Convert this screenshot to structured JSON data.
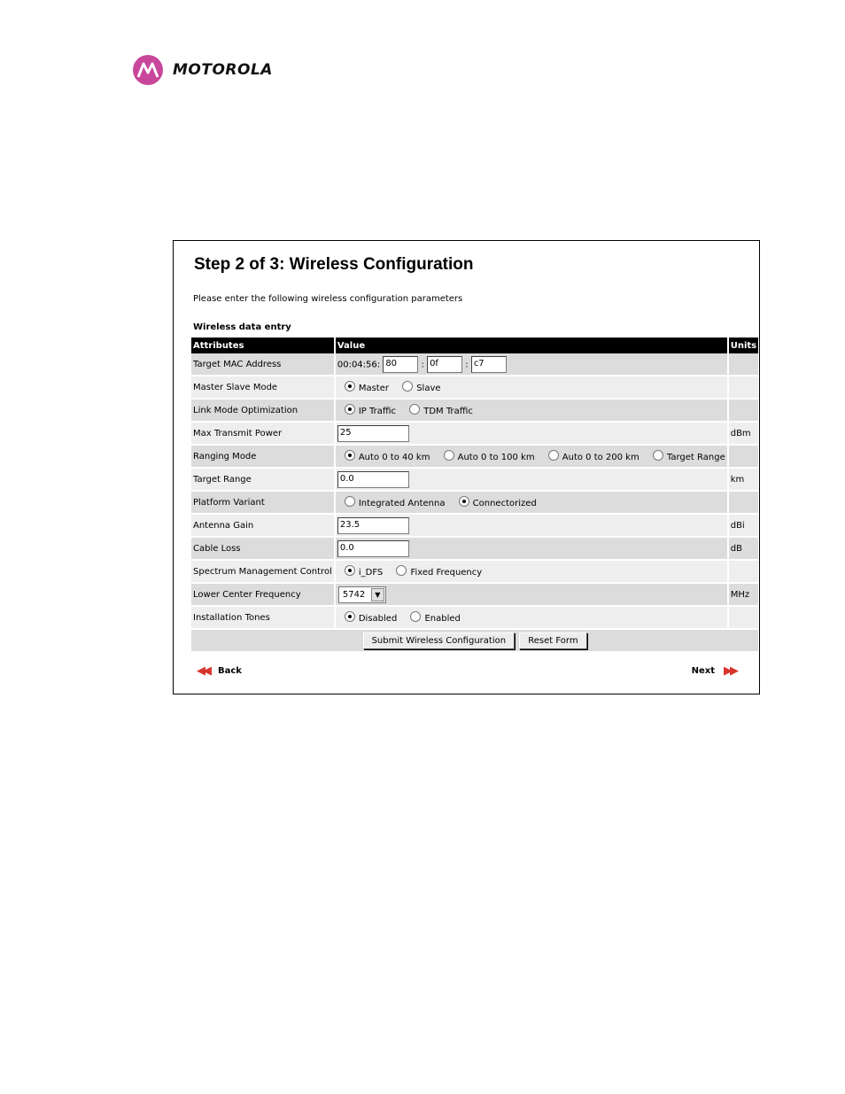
{
  "brand": {
    "name": "MOTOROLA",
    "logo_color": "#c8479b"
  },
  "page": {
    "title": "Step 2 of 3: Wireless Configuration",
    "intro": "Please enter the following wireless configuration parameters",
    "section_label": "Wireless data entry"
  },
  "table": {
    "headers": {
      "attributes": "Attributes",
      "value": "Value",
      "units": "Units"
    },
    "rows": {
      "mac": {
        "label": "Target MAC Address",
        "prefix": "00:04:56:",
        "sep": ":",
        "oct1": "80",
        "oct2": "0f",
        "oct3": "c7",
        "units": ""
      },
      "master_slave": {
        "label": "Master Slave Mode",
        "opt1": "Master",
        "opt2": "Slave",
        "selected": "Master"
      },
      "link_mode": {
        "label": "Link Mode Optimization",
        "opt1": "IP Traffic",
        "opt2": "TDM Traffic",
        "selected": "IP Traffic"
      },
      "tx_power": {
        "label": "Max Transmit Power",
        "value": "25",
        "units": "dBm"
      },
      "ranging": {
        "label": "Ranging Mode",
        "opt1": "Auto 0 to 40 km",
        "opt2": "Auto 0 to 100 km",
        "opt3": "Auto 0 to 200 km",
        "opt4": "Target Range",
        "selected": "Auto 0 to 40 km"
      },
      "target_range": {
        "label": "Target Range",
        "value": "0.0",
        "units": "km"
      },
      "platform": {
        "label": "Platform Variant",
        "opt1": "Integrated Antenna",
        "opt2": "Connectorized",
        "selected": "Connectorized"
      },
      "antenna_gain": {
        "label": "Antenna Gain",
        "value": "23.5",
        "units": "dBi"
      },
      "cable_loss": {
        "label": "Cable Loss",
        "value": "0.0",
        "units": "dB"
      },
      "spectrum": {
        "label": "Spectrum Management Control",
        "opt1": "i_DFS",
        "opt2": "Fixed Frequency",
        "selected": "i_DFS"
      },
      "lower_freq": {
        "label": "Lower Center Frequency",
        "value": "5742",
        "units": "MHz"
      },
      "tones": {
        "label": "Installation Tones",
        "opt1": "Disabled",
        "opt2": "Enabled",
        "selected": "Disabled"
      }
    }
  },
  "buttons": {
    "submit": "Submit Wireless Configuration",
    "reset": "Reset Form"
  },
  "nav": {
    "back": "Back",
    "next": "Next",
    "back_arrows": "◀◀",
    "next_arrows": "▶▶",
    "arrow_color": "#d9342b"
  }
}
